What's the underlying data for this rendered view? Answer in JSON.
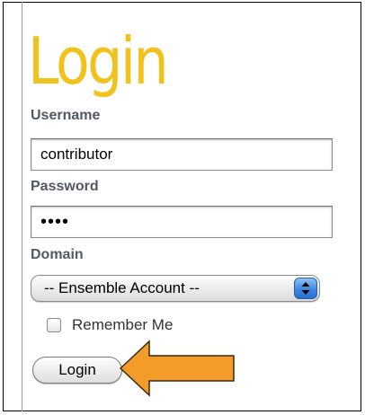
{
  "login_panel": {
    "title": "Login",
    "username": {
      "label": "Username",
      "value": "contributor"
    },
    "password": {
      "label": "Password",
      "masked_value": "••••"
    },
    "domain": {
      "label": "Domain",
      "selected": "-- Ensemble Account --"
    },
    "remember_me": {
      "label": "Remember Me",
      "checked": false
    },
    "submit_label": "Login"
  },
  "colors": {
    "title": "#f2c21c",
    "field_label": "#4f5a66",
    "annotation_arrow": "#f39c2a",
    "select_stepper": "#3d86e0"
  },
  "annotation": {
    "icon": "arrow-left-icon",
    "target": "login-button"
  }
}
